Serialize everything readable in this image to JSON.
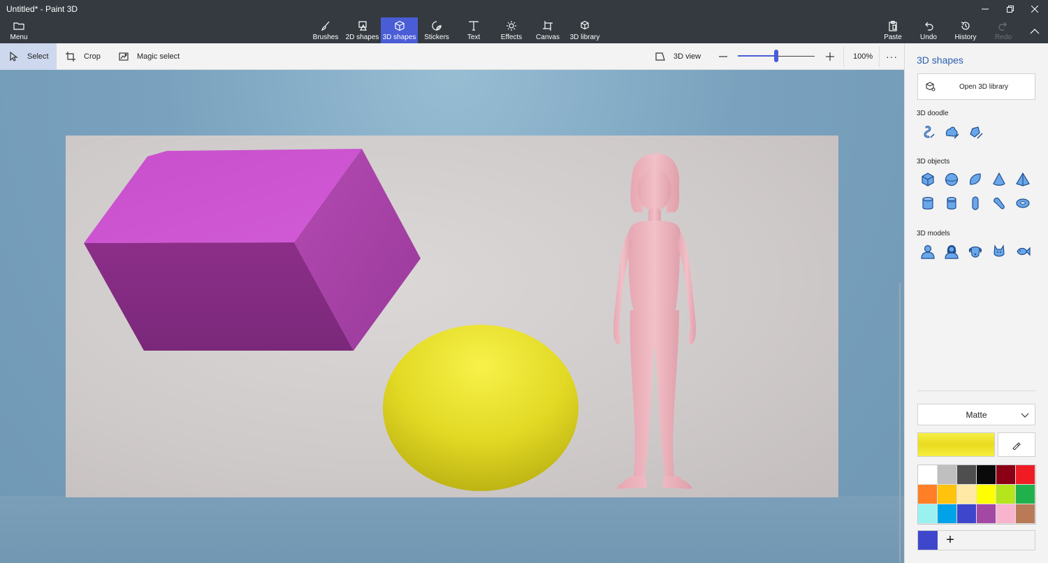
{
  "window": {
    "title": "Untitled* - Paint 3D"
  },
  "ribbon": {
    "menu_label": "Menu",
    "tabs": [
      {
        "label": "Brushes",
        "icon": "brush-icon"
      },
      {
        "label": "2D shapes",
        "icon": "2d-shapes-icon"
      },
      {
        "label": "3D shapes",
        "icon": "3d-shapes-icon",
        "active": true
      },
      {
        "label": "Stickers",
        "icon": "stickers-icon"
      },
      {
        "label": "Text",
        "icon": "text-icon"
      },
      {
        "label": "Effects",
        "icon": "effects-icon"
      },
      {
        "label": "Canvas",
        "icon": "canvas-icon"
      },
      {
        "label": "3D library",
        "icon": "3d-library-icon"
      }
    ],
    "right": {
      "paste_label": "Paste",
      "undo_label": "Undo",
      "history_label": "History",
      "redo_label": "Redo"
    }
  },
  "toolbar": {
    "select_label": "Select",
    "crop_label": "Crop",
    "magic_select_label": "Magic select",
    "view_3d_label": "3D view",
    "zoom_label": "100%",
    "zoom_slider_fraction": 0.5
  },
  "panel": {
    "title": "3D shapes",
    "open_library_label": "Open 3D library",
    "doodle_label": "3D doodle",
    "objects_label": "3D objects",
    "models_label": "3D models",
    "doodles": [
      "sharp-doodle-icon",
      "soft-doodle-icon",
      "tube-doodle-icon"
    ],
    "objects": [
      "cube-icon",
      "sphere-icon",
      "hemisphere-icon",
      "cone-icon",
      "pyramid-icon",
      "cylinder-icon",
      "tube-icon",
      "capsule-icon",
      "bent-tube-icon",
      "donut-icon"
    ],
    "models": [
      "man-icon",
      "woman-icon",
      "dog-icon",
      "cat-icon",
      "fish-icon"
    ],
    "material_label": "Matte",
    "current_color": "#f2e835",
    "palette": [
      "#ffffff",
      "#bfbfbf",
      "#4e4e4e",
      "#0a0a0a",
      "#8b0014",
      "#ef1c24",
      "#ff7f26",
      "#ffc20d",
      "#ffe9a4",
      "#ffff00",
      "#b5e51d",
      "#21b14c",
      "#99f2f0",
      "#00a3e8",
      "#3e47cc",
      "#a349a4",
      "#f7b4cc",
      "#b97a57"
    ],
    "custom_color": "#3e47cc"
  }
}
